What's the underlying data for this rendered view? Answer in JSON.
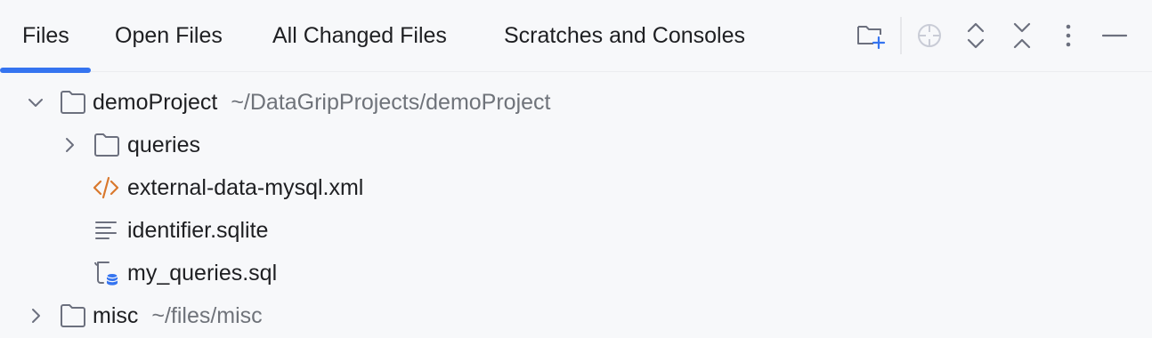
{
  "tabs": [
    {
      "label": "Files",
      "active": true
    },
    {
      "label": "Open Files",
      "active": false
    },
    {
      "label": "All Changed Files",
      "active": false
    },
    {
      "label": "Scratches and Consoles",
      "active": false
    }
  ],
  "toolbar": {
    "icons": [
      "new-folder-icon",
      "locate-icon",
      "expand-all-icon",
      "collapse-all-icon",
      "more-options-icon",
      "minimize-icon"
    ]
  },
  "tree": {
    "rows": [
      {
        "name": "demoProject",
        "path": "~/DataGripProjects/demoProject",
        "icon": "folder-icon",
        "expanded": true
      },
      {
        "name": "queries",
        "icon": "folder-icon",
        "expanded": false
      },
      {
        "name": "external-data-mysql.xml",
        "icon": "xml-file-icon"
      },
      {
        "name": "identifier.sqlite",
        "icon": "text-file-icon"
      },
      {
        "name": "my_queries.sql",
        "icon": "sql-file-icon"
      },
      {
        "name": "misc",
        "path": "~/files/misc",
        "icon": "folder-icon",
        "expanded": false
      }
    ]
  },
  "colors": {
    "background": "#f7f8fa",
    "accent": "#3574f0",
    "text": "#1e1f22",
    "secondary_text": "#6f737a",
    "xml_icon": "#d9782d",
    "db_badge": "#3574f0"
  }
}
